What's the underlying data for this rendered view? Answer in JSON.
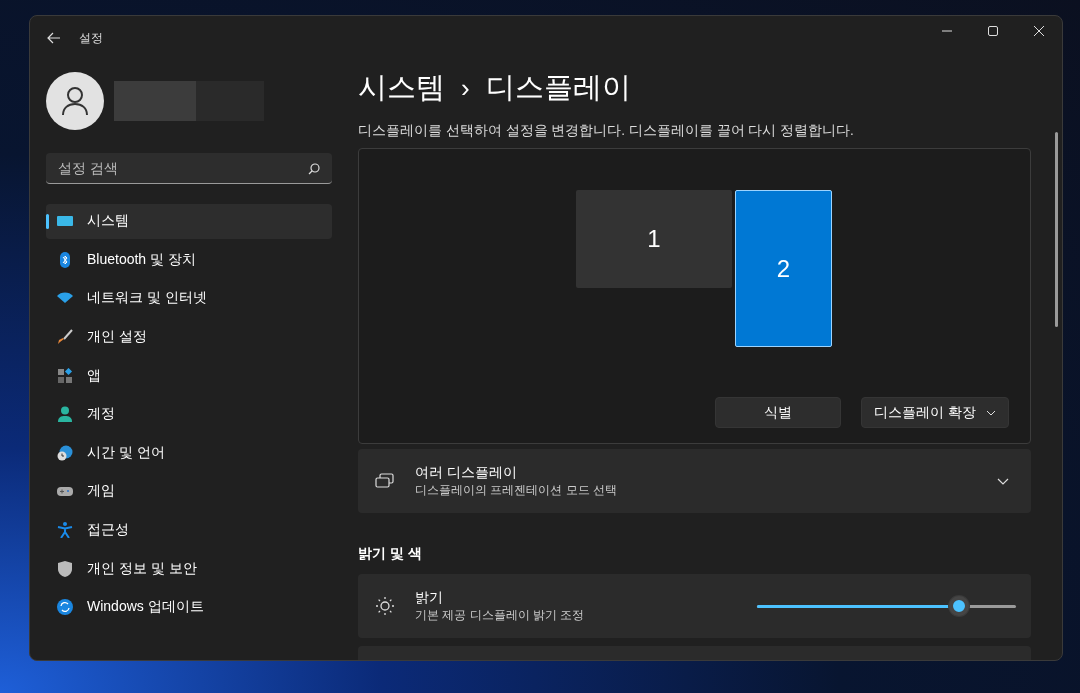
{
  "window": {
    "title": "설정"
  },
  "search": {
    "placeholder": "설정 검색"
  },
  "sidebar": {
    "items": [
      {
        "label": "시스템",
        "selected": true
      },
      {
        "label": "Bluetooth 및 장치",
        "selected": false
      },
      {
        "label": "네트워크 및 인터넷",
        "selected": false
      },
      {
        "label": "개인 설정",
        "selected": false
      },
      {
        "label": "앱",
        "selected": false
      },
      {
        "label": "계정",
        "selected": false
      },
      {
        "label": "시간 및 언어",
        "selected": false
      },
      {
        "label": "게임",
        "selected": false
      },
      {
        "label": "접근성",
        "selected": false
      },
      {
        "label": "개인 정보 및 보안",
        "selected": false
      },
      {
        "label": "Windows 업데이트",
        "selected": false
      }
    ]
  },
  "breadcrumb": {
    "parent": "시스템",
    "separator": "›",
    "current": "디스플레이"
  },
  "description": "디스플레이를 선택하여 설정을 변경합니다. 디스플레이를 끌어 다시 정렬합니다.",
  "arrangement": {
    "monitors": [
      {
        "label": "1",
        "selected": false
      },
      {
        "label": "2",
        "selected": true
      }
    ],
    "identify_button": "식별",
    "mode_dropdown": "디스플레이 확장"
  },
  "multiple_displays": {
    "title": "여러 디스플레이",
    "subtitle": "디스플레이의 프레젠테이션 모드 선택",
    "expanded": false
  },
  "section_title": "밝기 및 색",
  "brightness": {
    "title": "밝기",
    "subtitle": "기본 제공 디스플레이 밝기 조정",
    "level": 0.78
  }
}
